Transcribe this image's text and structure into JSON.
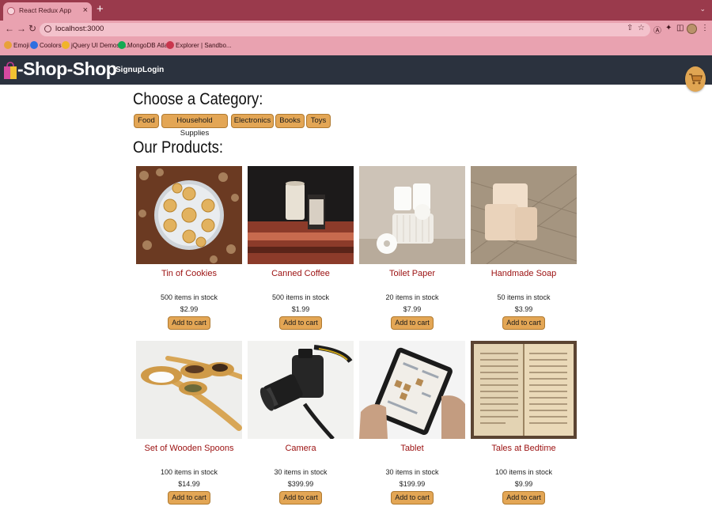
{
  "browser": {
    "tab_title": "React Redux App",
    "tab_close": "×",
    "new_tab": "+",
    "url": "localhost:3000",
    "bookmarks": [
      {
        "label": "Emoji",
        "icon": "emoji-icon",
        "color": "#e8a13a"
      },
      {
        "label": "Coolors",
        "icon": "coolors-icon",
        "color": "#2f6fe0"
      },
      {
        "label": "jQuery UI Demos |...",
        "icon": "jquery-icon",
        "color": "#f0b429"
      },
      {
        "label": "MongoDB Atlas",
        "icon": "mongodb-icon",
        "color": "#13aa52"
      },
      {
        "label": "Explorer | Sandbo...",
        "icon": "explorer-icon",
        "color": "#c9364d"
      }
    ]
  },
  "header": {
    "brand": "-Shop-Shop",
    "nav": {
      "signup": "Signup",
      "login": "Login"
    }
  },
  "categories": {
    "heading": "Choose a Category:",
    "items": [
      "Food",
      "Household Supplies",
      "Electronics",
      "Books",
      "Toys"
    ]
  },
  "products": {
    "heading": "Our Products:",
    "add_label": "Add to cart",
    "items": [
      {
        "name": "Tin of Cookies",
        "stock": "500 items in stock",
        "price": "$2.99",
        "image": "cookie-tin"
      },
      {
        "name": "Canned Coffee",
        "stock": "500 items in stock",
        "price": "$1.99",
        "image": "canned-coffee"
      },
      {
        "name": "Toilet Paper",
        "stock": "20 items in stock",
        "price": "$7.99",
        "image": "toilet-paper"
      },
      {
        "name": "Handmade Soap",
        "stock": "50 items in stock",
        "price": "$3.99",
        "image": "soap"
      },
      {
        "name": "Set of Wooden Spoons",
        "stock": "100 items in stock",
        "price": "$14.99",
        "image": "wooden-spoons"
      },
      {
        "name": "Camera",
        "stock": "30 items in stock",
        "price": "$399.99",
        "image": "camera"
      },
      {
        "name": "Tablet",
        "stock": "30 items in stock",
        "price": "$199.99",
        "image": "tablet"
      },
      {
        "name": "Tales at Bedtime",
        "stock": "100 items in stock",
        "price": "$9.99",
        "image": "open-book"
      }
    ]
  },
  "colors": {
    "browser_frame": "#9a3a4c",
    "browser_toolbar": "#e9a2b0",
    "app_header": "#2b323e",
    "button": "#e3a655",
    "product_name": "#9b1010"
  }
}
